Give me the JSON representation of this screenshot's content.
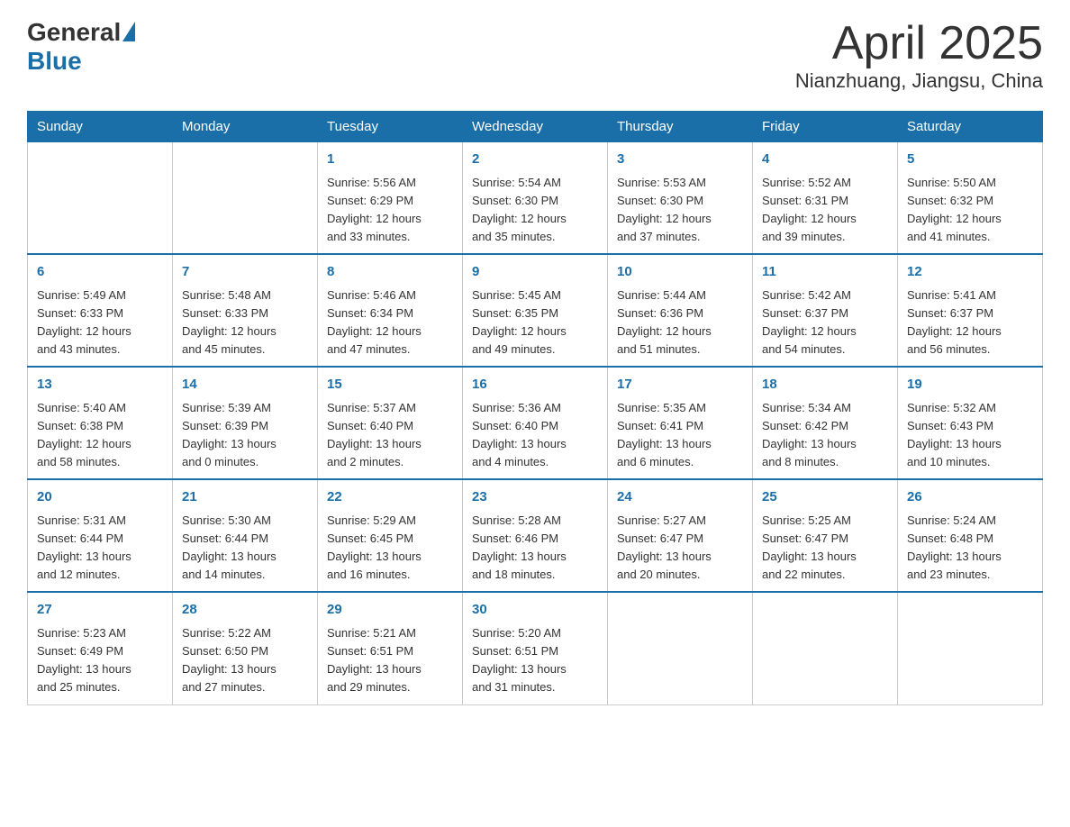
{
  "header": {
    "logo_general": "General",
    "logo_blue": "Blue",
    "month_title": "April 2025",
    "location": "Nianzhuang, Jiangsu, China"
  },
  "weekdays": [
    "Sunday",
    "Monday",
    "Tuesday",
    "Wednesday",
    "Thursday",
    "Friday",
    "Saturday"
  ],
  "weeks": [
    [
      {
        "day": "",
        "info": ""
      },
      {
        "day": "",
        "info": ""
      },
      {
        "day": "1",
        "info": "Sunrise: 5:56 AM\nSunset: 6:29 PM\nDaylight: 12 hours\nand 33 minutes."
      },
      {
        "day": "2",
        "info": "Sunrise: 5:54 AM\nSunset: 6:30 PM\nDaylight: 12 hours\nand 35 minutes."
      },
      {
        "day": "3",
        "info": "Sunrise: 5:53 AM\nSunset: 6:30 PM\nDaylight: 12 hours\nand 37 minutes."
      },
      {
        "day": "4",
        "info": "Sunrise: 5:52 AM\nSunset: 6:31 PM\nDaylight: 12 hours\nand 39 minutes."
      },
      {
        "day": "5",
        "info": "Sunrise: 5:50 AM\nSunset: 6:32 PM\nDaylight: 12 hours\nand 41 minutes."
      }
    ],
    [
      {
        "day": "6",
        "info": "Sunrise: 5:49 AM\nSunset: 6:33 PM\nDaylight: 12 hours\nand 43 minutes."
      },
      {
        "day": "7",
        "info": "Sunrise: 5:48 AM\nSunset: 6:33 PM\nDaylight: 12 hours\nand 45 minutes."
      },
      {
        "day": "8",
        "info": "Sunrise: 5:46 AM\nSunset: 6:34 PM\nDaylight: 12 hours\nand 47 minutes."
      },
      {
        "day": "9",
        "info": "Sunrise: 5:45 AM\nSunset: 6:35 PM\nDaylight: 12 hours\nand 49 minutes."
      },
      {
        "day": "10",
        "info": "Sunrise: 5:44 AM\nSunset: 6:36 PM\nDaylight: 12 hours\nand 51 minutes."
      },
      {
        "day": "11",
        "info": "Sunrise: 5:42 AM\nSunset: 6:37 PM\nDaylight: 12 hours\nand 54 minutes."
      },
      {
        "day": "12",
        "info": "Sunrise: 5:41 AM\nSunset: 6:37 PM\nDaylight: 12 hours\nand 56 minutes."
      }
    ],
    [
      {
        "day": "13",
        "info": "Sunrise: 5:40 AM\nSunset: 6:38 PM\nDaylight: 12 hours\nand 58 minutes."
      },
      {
        "day": "14",
        "info": "Sunrise: 5:39 AM\nSunset: 6:39 PM\nDaylight: 13 hours\nand 0 minutes."
      },
      {
        "day": "15",
        "info": "Sunrise: 5:37 AM\nSunset: 6:40 PM\nDaylight: 13 hours\nand 2 minutes."
      },
      {
        "day": "16",
        "info": "Sunrise: 5:36 AM\nSunset: 6:40 PM\nDaylight: 13 hours\nand 4 minutes."
      },
      {
        "day": "17",
        "info": "Sunrise: 5:35 AM\nSunset: 6:41 PM\nDaylight: 13 hours\nand 6 minutes."
      },
      {
        "day": "18",
        "info": "Sunrise: 5:34 AM\nSunset: 6:42 PM\nDaylight: 13 hours\nand 8 minutes."
      },
      {
        "day": "19",
        "info": "Sunrise: 5:32 AM\nSunset: 6:43 PM\nDaylight: 13 hours\nand 10 minutes."
      }
    ],
    [
      {
        "day": "20",
        "info": "Sunrise: 5:31 AM\nSunset: 6:44 PM\nDaylight: 13 hours\nand 12 minutes."
      },
      {
        "day": "21",
        "info": "Sunrise: 5:30 AM\nSunset: 6:44 PM\nDaylight: 13 hours\nand 14 minutes."
      },
      {
        "day": "22",
        "info": "Sunrise: 5:29 AM\nSunset: 6:45 PM\nDaylight: 13 hours\nand 16 minutes."
      },
      {
        "day": "23",
        "info": "Sunrise: 5:28 AM\nSunset: 6:46 PM\nDaylight: 13 hours\nand 18 minutes."
      },
      {
        "day": "24",
        "info": "Sunrise: 5:27 AM\nSunset: 6:47 PM\nDaylight: 13 hours\nand 20 minutes."
      },
      {
        "day": "25",
        "info": "Sunrise: 5:25 AM\nSunset: 6:47 PM\nDaylight: 13 hours\nand 22 minutes."
      },
      {
        "day": "26",
        "info": "Sunrise: 5:24 AM\nSunset: 6:48 PM\nDaylight: 13 hours\nand 23 minutes."
      }
    ],
    [
      {
        "day": "27",
        "info": "Sunrise: 5:23 AM\nSunset: 6:49 PM\nDaylight: 13 hours\nand 25 minutes."
      },
      {
        "day": "28",
        "info": "Sunrise: 5:22 AM\nSunset: 6:50 PM\nDaylight: 13 hours\nand 27 minutes."
      },
      {
        "day": "29",
        "info": "Sunrise: 5:21 AM\nSunset: 6:51 PM\nDaylight: 13 hours\nand 29 minutes."
      },
      {
        "day": "30",
        "info": "Sunrise: 5:20 AM\nSunset: 6:51 PM\nDaylight: 13 hours\nand 31 minutes."
      },
      {
        "day": "",
        "info": ""
      },
      {
        "day": "",
        "info": ""
      },
      {
        "day": "",
        "info": ""
      }
    ]
  ]
}
